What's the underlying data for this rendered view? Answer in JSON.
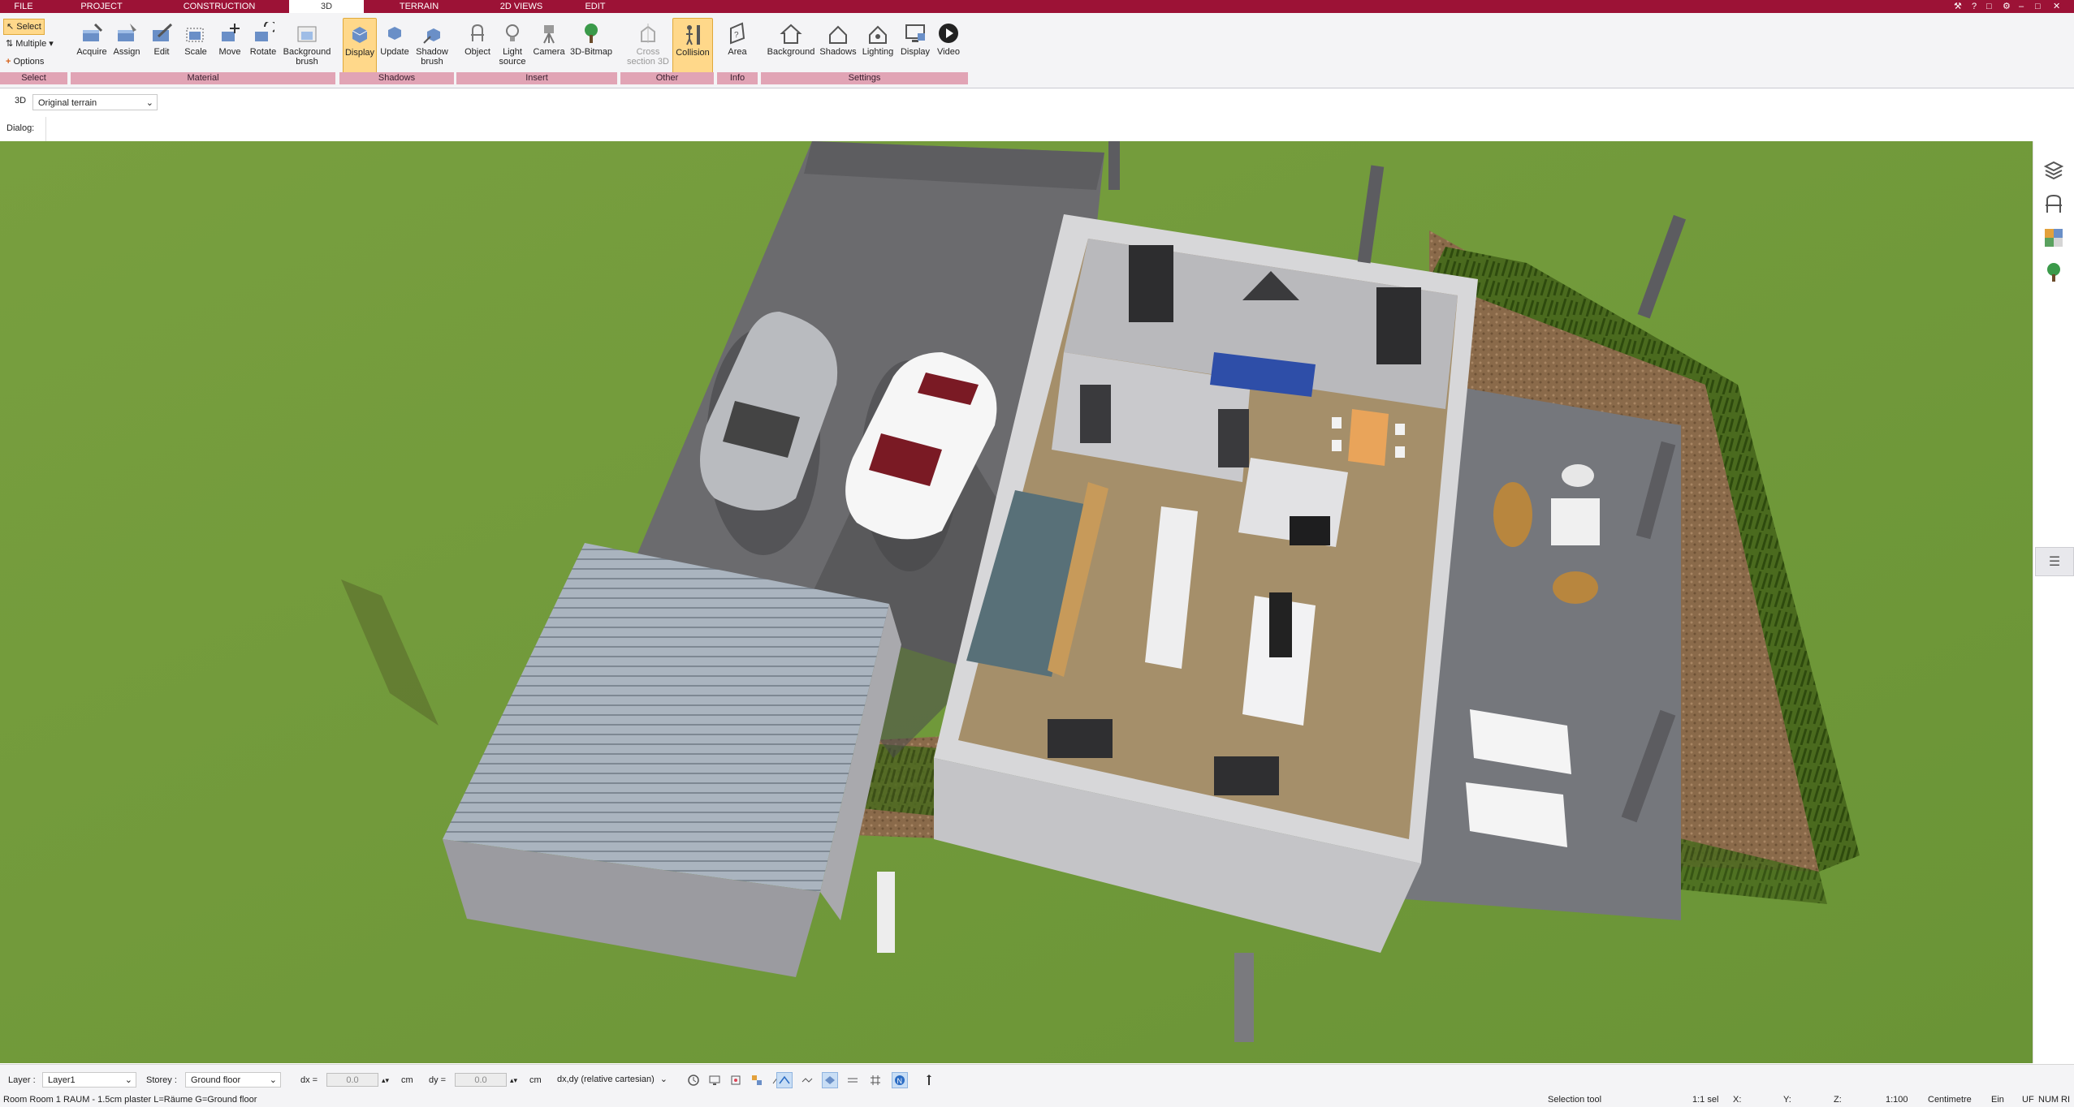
{
  "tabs": [
    {
      "label": "FILE",
      "active": false
    },
    {
      "label": "PROJECT",
      "active": false
    },
    {
      "label": "CONSTRUCTION",
      "active": false
    },
    {
      "label": "3D",
      "active": true
    },
    {
      "label": "TERRAIN",
      "active": false
    },
    {
      "label": "2D VIEWS",
      "active": false
    },
    {
      "label": "EDIT",
      "active": false
    }
  ],
  "ribbon": {
    "select": {
      "select_label": "Select",
      "multiple_label": "Multiple",
      "options_label": "Options",
      "group": "Select"
    },
    "material": {
      "buttons": [
        {
          "label": "Acquire",
          "icon": "acquire-icon"
        },
        {
          "label": "Assign",
          "icon": "assign-icon"
        },
        {
          "label": "Edit",
          "icon": "edit-icon"
        },
        {
          "label": "Scale",
          "icon": "scale-icon"
        },
        {
          "label": "Move",
          "icon": "move-icon"
        },
        {
          "label": "Rotate",
          "icon": "rotate-icon"
        },
        {
          "label": "Background",
          "label2": "brush",
          "icon": "background-brush-icon"
        }
      ],
      "group": "Material"
    },
    "shadows": {
      "buttons": [
        {
          "label": "Display",
          "icon": "display-shadows-icon",
          "active": true
        },
        {
          "label": "Update",
          "icon": "update-icon"
        },
        {
          "label": "Shadow",
          "label2": "brush",
          "icon": "shadow-brush-icon"
        }
      ],
      "group": "Shadows"
    },
    "insert": {
      "buttons": [
        {
          "label": "Object",
          "icon": "object-icon"
        },
        {
          "label": "Light",
          "label2": "source",
          "icon": "light-source-icon"
        },
        {
          "label": "Camera",
          "icon": "camera-icon"
        },
        {
          "label": "3D-Bitmap",
          "icon": "tree-bitmap-icon"
        }
      ],
      "group": "Insert"
    },
    "other": {
      "buttons": [
        {
          "label": "Cross",
          "label2": "section 3D",
          "icon": "cross-section-icon",
          "disabled": true
        },
        {
          "label": "Collision",
          "icon": "collision-icon",
          "active": true
        }
      ],
      "group": "Other"
    },
    "info": {
      "buttons": [
        {
          "label": "Area",
          "icon": "area-icon"
        }
      ],
      "group": "Info"
    },
    "settings": {
      "buttons": [
        {
          "label": "Background",
          "icon": "background-icon"
        },
        {
          "label": "Shadows",
          "icon": "shadows-settings-icon"
        },
        {
          "label": "Lighting",
          "icon": "lighting-icon"
        },
        {
          "label": "Display",
          "icon": "display-settings-icon"
        },
        {
          "label": "Video",
          "icon": "video-icon"
        }
      ],
      "group": "Settings"
    }
  },
  "view": {
    "mode_label": "3D",
    "terrain_value": "Original terrain"
  },
  "dialog_label": "Dialog:",
  "statusbar": {
    "layer_label": "Layer :",
    "layer_value": "Layer1",
    "storey_label": "Storey :",
    "storey_value": "Ground floor",
    "dx_label": "dx =",
    "dx_value": "0.0",
    "dx_unit": "cm",
    "dy_label": "dy =",
    "dy_value": "0.0",
    "dy_unit": "cm",
    "coord_mode": "dx,dy (relative cartesian)"
  },
  "infobar": {
    "status_text": "Room Room 1 RAUM - 1.5cm plaster L=Räume G=Ground floor",
    "tool": "Selection tool",
    "scale_sel": "1:1 sel",
    "x_label": "X:",
    "y_label": "Y:",
    "z_label": "Z:",
    "scale": "1:100",
    "unit": "Centimetre",
    "ein": "Ein",
    "uf": "UF",
    "num": "NUM",
    "ri": "RI"
  },
  "colors": {
    "accent": "#9c1236",
    "group_bar": "#e1a4b5",
    "active_button": "#ffd88a",
    "grass": "#6f9a3a"
  }
}
